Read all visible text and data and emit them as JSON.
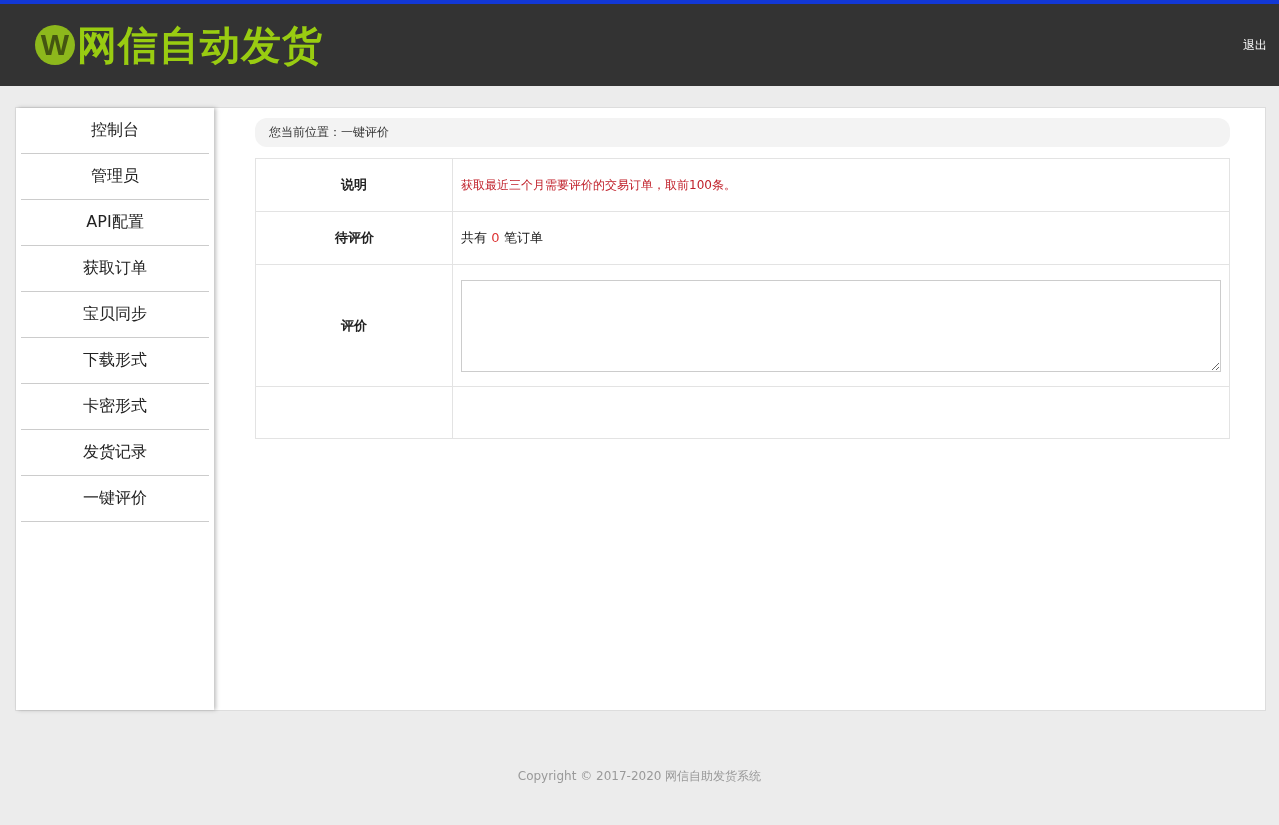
{
  "header": {
    "logo_mark": "W",
    "logo_text": "网信自动发货",
    "logout": "退出"
  },
  "sidebar": {
    "items": [
      {
        "label": "控制台",
        "selected": false
      },
      {
        "label": "管理员",
        "selected": false
      },
      {
        "label": "API配置",
        "selected": false
      },
      {
        "label": "获取订单",
        "selected": false
      },
      {
        "label": "宝贝同步",
        "selected": false
      },
      {
        "label": "下载形式",
        "selected": false
      },
      {
        "label": "卡密形式",
        "selected": false
      },
      {
        "label": "发货记录",
        "selected": false
      },
      {
        "label": "一键评价",
        "selected": false
      }
    ]
  },
  "breadcrumb": "您当前位置：一键评价",
  "form": {
    "rows": [
      {
        "kind": "note",
        "label": "说明",
        "text": "获取最近三个月需要评价的交易订单，取前100条。"
      },
      {
        "kind": "count",
        "label": "待评价",
        "prefix": "共有",
        "count": "0",
        "suffix": "笔订单"
      },
      {
        "kind": "textarea",
        "label": "评价"
      },
      {
        "kind": "empty"
      }
    ]
  },
  "footer": "Copyright © 2017-2020 网信自助发货系统"
}
